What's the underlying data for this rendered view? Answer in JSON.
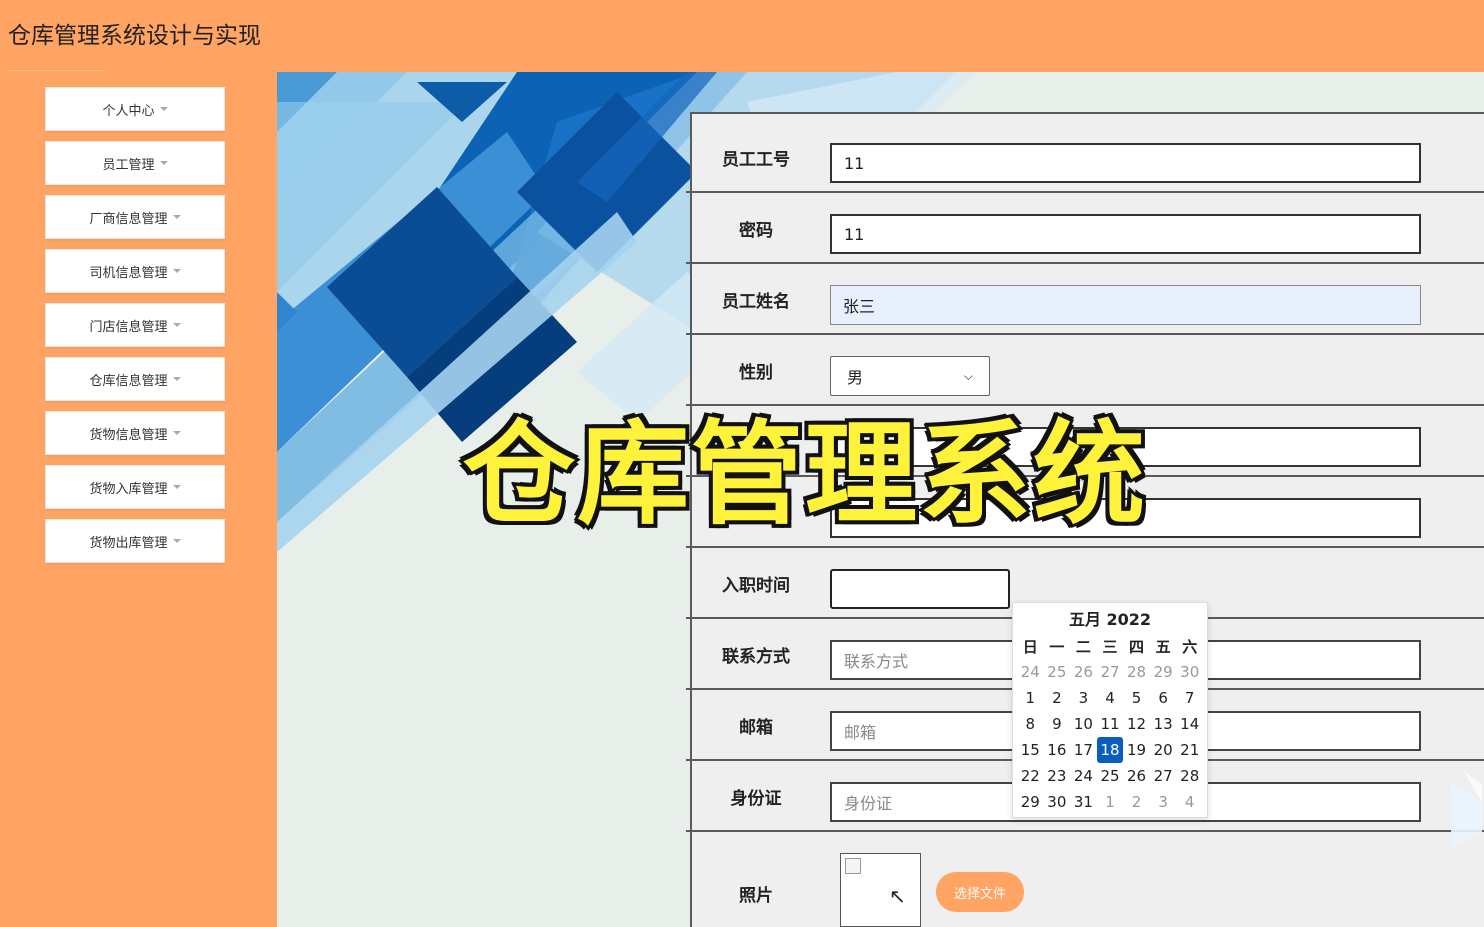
{
  "app": {
    "title": "仓库管理系统设计与实现"
  },
  "sidebar": {
    "items": [
      {
        "label": "个人中心"
      },
      {
        "label": "员工管理"
      },
      {
        "label": "厂商信息管理"
      },
      {
        "label": "司机信息管理"
      },
      {
        "label": "门店信息管理"
      },
      {
        "label": "仓库信息管理"
      },
      {
        "label": "货物信息管理"
      },
      {
        "label": "货物入库管理"
      },
      {
        "label": "货物出库管理"
      }
    ]
  },
  "form": {
    "employee_no": {
      "label": "员工工号",
      "value": "11"
    },
    "password": {
      "label": "密码",
      "value": "11"
    },
    "name": {
      "label": "员工姓名",
      "value": "张三"
    },
    "gender": {
      "label": "性别",
      "value": "男"
    },
    "hire_date": {
      "label": "入职时间",
      "value": ""
    },
    "contact": {
      "label": "联系方式",
      "placeholder": "联系方式"
    },
    "email": {
      "label": "邮箱",
      "placeholder": "邮箱"
    },
    "id_card": {
      "label": "身份证",
      "placeholder": "身份证"
    },
    "photo": {
      "label": "照片",
      "button": "选择文件"
    }
  },
  "calendar": {
    "month_title": "五月 2022",
    "weekdays": [
      "日",
      "一",
      "二",
      "三",
      "四",
      "五",
      "六"
    ],
    "weeks": [
      [
        "24",
        "25",
        "26",
        "27",
        "28",
        "29",
        "30"
      ],
      [
        "1",
        "2",
        "3",
        "4",
        "5",
        "6",
        "7"
      ],
      [
        "8",
        "9",
        "10",
        "11",
        "12",
        "13",
        "14"
      ],
      [
        "15",
        "16",
        "17",
        "18",
        "19",
        "20",
        "21"
      ],
      [
        "22",
        "23",
        "24",
        "25",
        "26",
        "27",
        "28"
      ],
      [
        "29",
        "30",
        "31",
        "1",
        "2",
        "3",
        "4"
      ]
    ],
    "selected": "18"
  },
  "overlay": {
    "text": "仓库管理系统"
  },
  "colors": {
    "accent": "#ffa462",
    "calendar_selected": "#0b5dc0",
    "overlay_text": "#fff23b"
  }
}
